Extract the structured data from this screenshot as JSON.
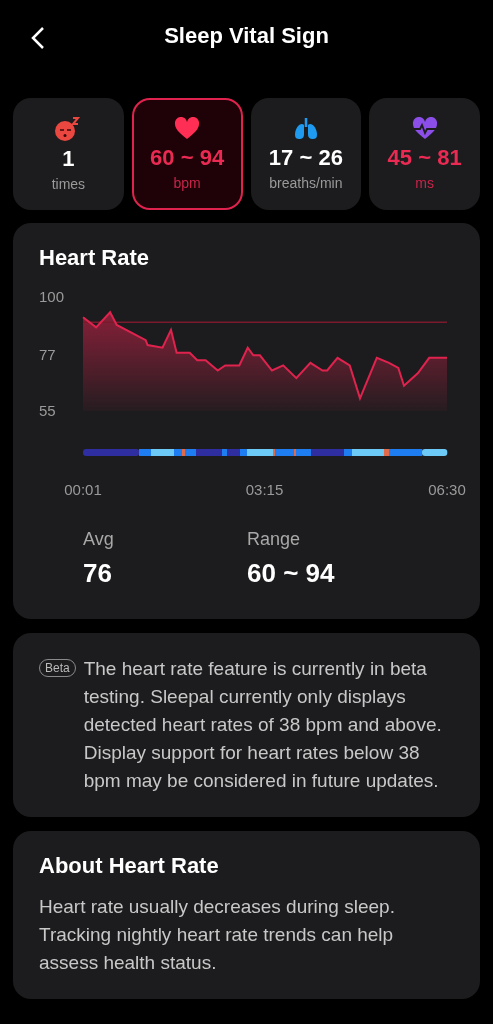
{
  "header": {
    "title": "Sleep Vital Sign"
  },
  "metrics": [
    {
      "kind": "snore",
      "value": "1",
      "unit": "times",
      "selected": false,
      "highlight": false
    },
    {
      "kind": "heart",
      "value": "60 ~ 94",
      "unit": "bpm",
      "selected": true,
      "highlight": true
    },
    {
      "kind": "lungs",
      "value": "17 ~ 26",
      "unit": "breaths/min",
      "selected": false,
      "highlight": false
    },
    {
      "kind": "hrv",
      "value": "45 ~ 81",
      "unit": "ms",
      "selected": false,
      "highlight": true
    }
  ],
  "heart_rate": {
    "title": "Heart Rate",
    "chart_data": {
      "type": "area",
      "x": [
        1,
        15,
        30,
        37,
        68,
        70,
        86,
        95,
        101,
        115,
        123,
        132,
        145,
        153,
        168,
        177,
        183,
        190,
        203,
        215,
        229,
        244,
        257,
        262,
        273,
        286,
        297,
        315,
        328,
        338,
        344,
        359,
        371,
        390
      ],
      "series": [
        {
          "color": "#e0234e",
          "values": [
            92,
            88,
            94,
            89,
            83,
            81,
            80,
            87,
            78,
            78,
            75,
            75,
            71,
            73,
            73,
            80,
            77,
            77,
            71,
            73,
            68,
            74,
            71,
            71,
            76,
            73,
            60,
            76,
            74,
            72,
            65,
            70,
            76,
            76
          ]
        }
      ],
      "xlim": [
        1,
        390
      ],
      "ylim": [
        55,
        100
      ],
      "xticks": [
        {
          "value": 1,
          "label": "00:01"
        },
        {
          "value": 195,
          "label": "03:15"
        },
        {
          "value": 390,
          "label": "06:30"
        }
      ],
      "yticks": [
        100,
        77,
        55
      ],
      "ref_lines": [
        {
          "axis": "y",
          "value": 90
        }
      ]
    },
    "stats": [
      {
        "label": "Avg",
        "value": "76"
      },
      {
        "label": "Range",
        "value": "60 ~ 94"
      }
    ]
  },
  "beta_note": {
    "badge": "Beta",
    "text": "The heart rate feature is currently in beta testing. Sleepal currently only displays detected heart rates of 38 bpm and above. Display support for heart rates below 38 bpm may be considered in future updates."
  },
  "about": {
    "title": "About Heart Rate",
    "text": "Heart rate usually decreases during sleep. Tracking nightly heart rate trends can help assess health status."
  }
}
